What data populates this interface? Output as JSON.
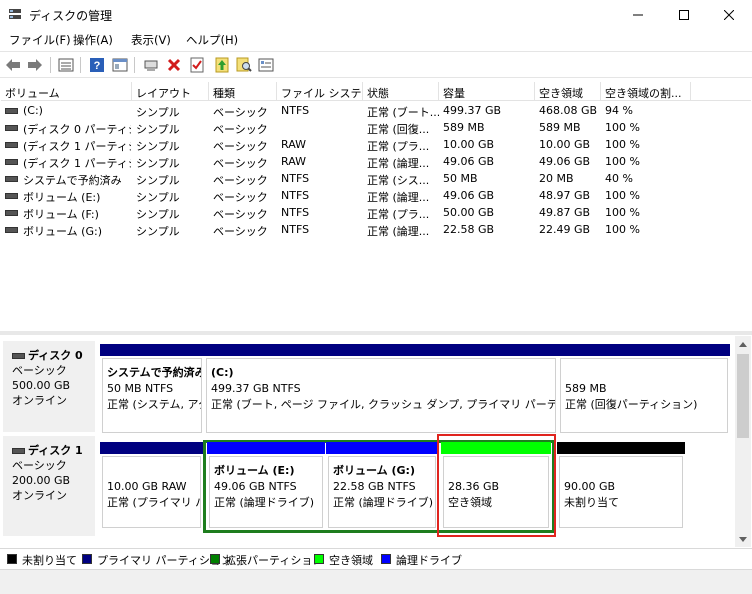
{
  "window": {
    "title": "ディスクの管理"
  },
  "menu": [
    "ファイル(F)",
    "操作(A)",
    "表示(V)",
    "ヘルプ(H)"
  ],
  "toolbar_icons": [
    "back-icon",
    "forward-icon",
    "list-view-icon",
    "help-icon",
    "properties-icon",
    "connect-icon",
    "delete-icon",
    "check-icon",
    "up-icon",
    "search-icon",
    "settings-icon"
  ],
  "columns": [
    "ボリューム",
    "レイアウト",
    "種類",
    "ファイル システム",
    "状態",
    "容量",
    "空き領域",
    "空き領域の割..."
  ],
  "volumes": [
    [
      "(C:)",
      "シンプル",
      "ベーシック",
      "NTFS",
      "正常 (ブート...",
      "499.37 GB",
      "468.08 GB",
      "94 %"
    ],
    [
      "(ディスク 0 パーティシ...",
      "シンプル",
      "ベーシック",
      "",
      "正常 (回復...",
      "589 MB",
      "589 MB",
      "100 %"
    ],
    [
      "(ディスク 1 パーティシ...",
      "シンプル",
      "ベーシック",
      "RAW",
      "正常 (プラ...",
      "10.00 GB",
      "10.00 GB",
      "100 %"
    ],
    [
      "(ディスク 1 パーティシ...",
      "シンプル",
      "ベーシック",
      "RAW",
      "正常 (論理...",
      "49.06 GB",
      "49.06 GB",
      "100 %"
    ],
    [
      "システムで予約済み",
      "シンプル",
      "ベーシック",
      "NTFS",
      "正常 (シス...",
      "50 MB",
      "20 MB",
      "40 %"
    ],
    [
      "ボリューム (E:)",
      "シンプル",
      "ベーシック",
      "NTFS",
      "正常 (論理...",
      "49.06 GB",
      "48.97 GB",
      "100 %"
    ],
    [
      "ボリューム (F:)",
      "シンプル",
      "ベーシック",
      "NTFS",
      "正常 (プラ...",
      "50.00 GB",
      "49.87 GB",
      "100 %"
    ],
    [
      "ボリューム (G:)",
      "シンプル",
      "ベーシック",
      "NTFS",
      "正常 (論理...",
      "22.58 GB",
      "22.49 GB",
      "100 %"
    ]
  ],
  "disks": [
    {
      "name": "ディスク 0",
      "type": "ベーシック",
      "size": "500.00 GB",
      "status": "オンライン",
      "partitions": [
        {
          "name": "システムで予約済み",
          "size": "50 MB NTFS",
          "status": "正常 (システム, アク"
        },
        {
          "name": "(C:)",
          "size": "499.37 GB NTFS",
          "status": "正常 (ブート, ページ ファイル, クラッシュ ダンプ, プライマリ パーティション)"
        },
        {
          "name": "",
          "size": "589 MB",
          "status": "正常 (回復パーティション)"
        }
      ]
    },
    {
      "name": "ディスク 1",
      "type": "ベーシック",
      "size": "200.00 GB",
      "status": "オンライン",
      "partitions": [
        {
          "name": "",
          "size": "10.00 GB RAW",
          "status": "正常 (プライマリ パ"
        },
        {
          "name": "ボリューム (E:)",
          "size": "49.06 GB NTFS",
          "status": "正常 (論理ドライブ)"
        },
        {
          "name": "ボリューム (G:)",
          "size": "22.58 GB NTFS",
          "status": "正常 (論理ドライブ)"
        },
        {
          "name": "",
          "size": "28.36 GB",
          "status": "空き領域"
        },
        {
          "name": "",
          "size": "90.00 GB",
          "status": "未割り当て"
        }
      ]
    }
  ],
  "legend": [
    {
      "label": "未割り当て",
      "color": "#000000"
    },
    {
      "label": "プライマリ パーティション",
      "color": "#000080"
    },
    {
      "label": "拡張パーティション",
      "color": "#008000"
    },
    {
      "label": "空き領域",
      "color": "#00ff00"
    },
    {
      "label": "論理ドライブ",
      "color": "#0000ff"
    }
  ]
}
